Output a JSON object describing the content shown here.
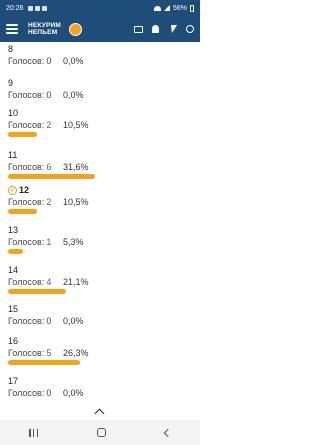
{
  "status_bar": {
    "time": "20:26",
    "battery": "56%"
  },
  "app_bar": {
    "logo_line1": "НЕКУРИМ",
    "logo_line2": "НЕПЬЕМ"
  },
  "poll": {
    "votes_label": "Голосов:",
    "options": [
      {
        "label": "8",
        "votes": "0",
        "percent": "0,0%",
        "share": 0.0
      },
      {
        "label": "9",
        "votes": "0",
        "percent": "0,0%",
        "share": 0.0
      },
      {
        "label": "10",
        "votes": "2",
        "percent": "10,5%",
        "share": 0.105
      },
      {
        "label": "11",
        "votes": "6",
        "percent": "31,6%",
        "share": 0.316
      },
      {
        "label": "12",
        "votes": "2",
        "percent": "10,5%",
        "share": 0.105,
        "selected": true
      },
      {
        "label": "13",
        "votes": "1",
        "percent": "5,3%",
        "share": 0.053
      },
      {
        "label": "14",
        "votes": "4",
        "percent": "21,1%",
        "share": 0.211
      },
      {
        "label": "15",
        "votes": "0",
        "percent": "0,0%",
        "share": 0.0
      },
      {
        "label": "16",
        "votes": "5",
        "percent": "26,3%",
        "share": 0.263
      },
      {
        "label": "17",
        "votes": "0",
        "percent": "0,0%",
        "share": 0.0
      }
    ]
  },
  "colors": {
    "header_bg": "#1f4d7a",
    "bar": "#f2a51a",
    "link": "#2d6eb5"
  }
}
